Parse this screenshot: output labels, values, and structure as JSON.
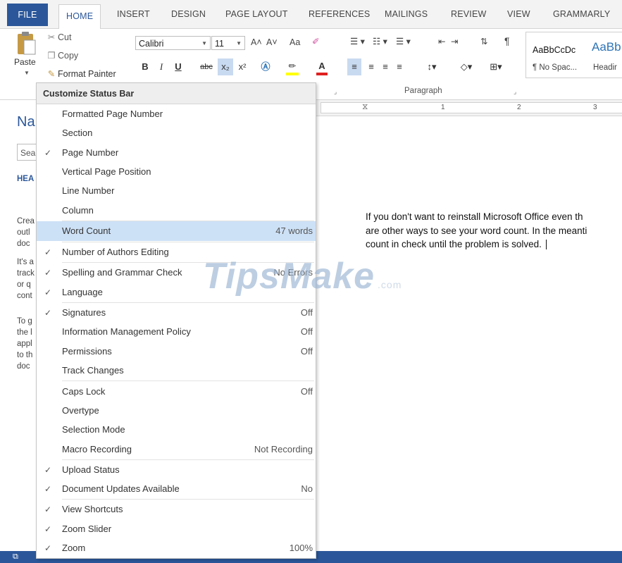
{
  "tabs": {
    "file": "FILE",
    "home": "HOME",
    "insert": "INSERT",
    "design": "DESIGN",
    "page_layout": "PAGE LAYOUT",
    "references": "REFERENCES",
    "mailings": "MAILINGS",
    "review": "REVIEW",
    "view": "VIEW",
    "grammarly": "GRAMMARLY"
  },
  "clipboard": {
    "paste": "Paste",
    "cut": "Cut",
    "copy": "Copy",
    "format_painter": "Format Painter"
  },
  "font": {
    "name": "Calibri",
    "size": "11",
    "grow": "A˄",
    "shrink": "A˅",
    "change_case": "Aa",
    "bold": "B",
    "italic": "I",
    "underline": "U",
    "strikethrough": "abc",
    "subscript": "x₂",
    "superscript": "x²"
  },
  "paragraph": {
    "label": "Paragraph",
    "pilcrow": "¶"
  },
  "styles": [
    {
      "sample": "AaBbCcDc",
      "name": "¶ No Spac..."
    },
    {
      "sample": "AaBb",
      "name": "Headir"
    }
  ],
  "ruler": {
    "numbers": [
      "1",
      "2",
      "3"
    ]
  },
  "nav_pane": {
    "title": "Na",
    "search": "Sea",
    "headings": "HEA",
    "lines": [
      "Crea",
      "outl",
      "doc",
      "It's a",
      "track",
      "or q",
      "cont",
      "To g",
      "the l",
      "appl",
      "to th",
      "doc"
    ]
  },
  "document": {
    "lines": [
      "If you don't want to reinstall Microsoft Office even th",
      "are other ways to see your word count. In the meanti",
      "count in check until the problem is solved."
    ]
  },
  "watermark": {
    "text": "TipsMake",
    "suffix": ".com"
  },
  "menu": {
    "title": "Customize Status Bar",
    "items": [
      {
        "label": "Formatted Page Number",
        "checked": false,
        "value": "",
        "highlight": false
      },
      {
        "label": "Section",
        "checked": false,
        "value": "",
        "highlight": false
      },
      {
        "label": "Page Number",
        "checked": true,
        "value": "",
        "highlight": false
      },
      {
        "label": "Vertical Page Position",
        "checked": false,
        "value": "",
        "highlight": false
      },
      {
        "label": "Line Number",
        "checked": false,
        "value": "",
        "highlight": false
      },
      {
        "label": "Column",
        "checked": false,
        "value": "",
        "highlight": false
      },
      {
        "label": "Word Count",
        "checked": false,
        "value": "47 words",
        "highlight": true
      },
      {
        "label": "Number of Authors Editing",
        "checked": true,
        "value": "",
        "highlight": false
      },
      {
        "label": "Spelling and Grammar Check",
        "checked": true,
        "value": "No Errors",
        "highlight": false
      },
      {
        "label": "Language",
        "checked": true,
        "value": "",
        "highlight": false
      },
      {
        "label": "Signatures",
        "checked": true,
        "value": "Off",
        "highlight": false
      },
      {
        "label": "Information Management Policy",
        "checked": false,
        "value": "Off",
        "highlight": false
      },
      {
        "label": "Permissions",
        "checked": false,
        "value": "Off",
        "highlight": false
      },
      {
        "label": "Track Changes",
        "checked": false,
        "value": "",
        "highlight": false
      },
      {
        "label": "Caps Lock",
        "checked": false,
        "value": "Off",
        "highlight": false
      },
      {
        "label": "Overtype",
        "checked": false,
        "value": "",
        "highlight": false
      },
      {
        "label": "Selection Mode",
        "checked": false,
        "value": "",
        "highlight": false
      },
      {
        "label": "Macro Recording",
        "checked": false,
        "value": "Not Recording",
        "highlight": false
      },
      {
        "label": "Upload Status",
        "checked": true,
        "value": "",
        "highlight": false
      },
      {
        "label": "Document Updates Available",
        "checked": true,
        "value": "No",
        "highlight": false
      },
      {
        "label": "View Shortcuts",
        "checked": true,
        "value": "",
        "highlight": false
      },
      {
        "label": "Zoom Slider",
        "checked": true,
        "value": "",
        "highlight": false
      },
      {
        "label": "Zoom",
        "checked": true,
        "value": "100%",
        "highlight": false
      }
    ]
  },
  "colors": {
    "accent": "#2b579a",
    "menu_highlight": "#cde1f6",
    "heading_style": "#2e74b5",
    "watermark": "#9bb5d4"
  }
}
